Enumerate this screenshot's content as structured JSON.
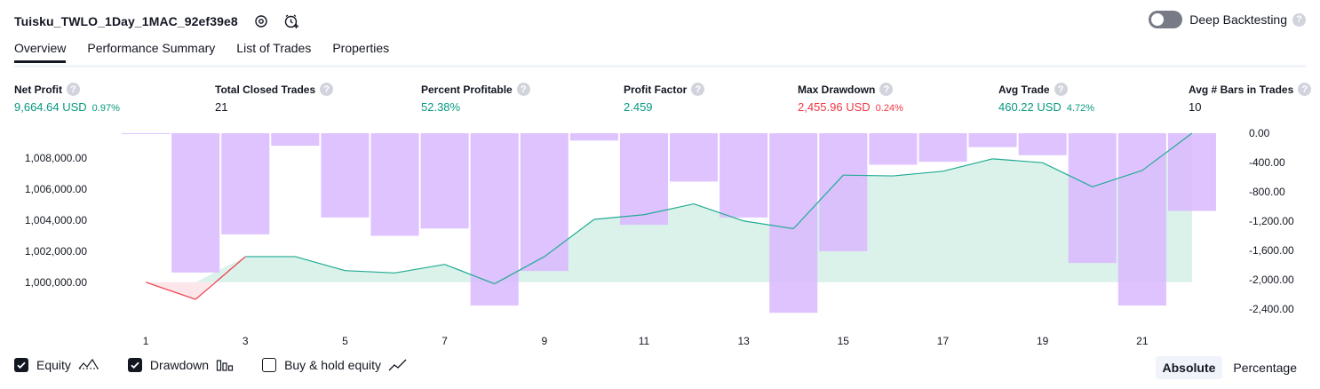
{
  "header": {
    "strategy_title": "Tuisku_TWLO_1Day_1MAC_92ef39e8",
    "deep_backtesting_label": "Deep Backtesting",
    "deep_backtesting_enabled": false
  },
  "tabs": [
    {
      "label": "Overview",
      "active": true
    },
    {
      "label": "Performance Summary",
      "active": false
    },
    {
      "label": "List of Trades",
      "active": false
    },
    {
      "label": "Properties",
      "active": false
    }
  ],
  "metrics": [
    {
      "label": "Net Profit",
      "value": "9,664.64 USD",
      "pct": "0.97%",
      "tone": "pos"
    },
    {
      "label": "Total Closed Trades",
      "value": "21",
      "pct": "",
      "tone": "neutral"
    },
    {
      "label": "Percent Profitable",
      "value": "52.38%",
      "pct": "",
      "tone": "pos"
    },
    {
      "label": "Profit Factor",
      "value": "2.459",
      "pct": "",
      "tone": "pos"
    },
    {
      "label": "Max Drawdown",
      "value": "2,455.96 USD",
      "pct": "0.24%",
      "tone": "neg"
    },
    {
      "label": "Avg Trade",
      "value": "460.22 USD",
      "pct": "4.72%",
      "tone": "pos"
    },
    {
      "label": "Avg # Bars in Trades",
      "value": "10",
      "pct": "",
      "tone": "neutral"
    }
  ],
  "colors": {
    "positive": "#089981",
    "negative": "#f23645",
    "drawdown_bar": "#d9b8ff",
    "equity_line": "#22ab94",
    "equity_fill": "#d5f0e8",
    "equity_loss_line": "#f23645"
  },
  "chart_data": {
    "type": "bar",
    "x_ticks": [
      "1",
      "3",
      "5",
      "7",
      "9",
      "11",
      "13",
      "15",
      "17",
      "19",
      "21"
    ],
    "x": [
      1,
      2,
      3,
      4,
      5,
      6,
      7,
      8,
      9,
      10,
      11,
      12,
      13,
      14,
      15,
      16,
      17,
      18,
      19,
      20,
      21,
      22
    ],
    "xlim": [
      0,
      23
    ],
    "left_axis": {
      "ticks": [
        "1,000,000.00",
        "1,002,000.00",
        "1,004,000.00",
        "1,006,000.00",
        "1,008,000.00"
      ],
      "tick_values": [
        1000000,
        1002000,
        1004000,
        1006000,
        1008000
      ],
      "ylim": [
        997700,
        1009600
      ]
    },
    "right_axis": {
      "ticks": [
        "0.00",
        "-400.00",
        "-800.00",
        "-1,200.00",
        "-1,600.00",
        "-2,000.00",
        "-2,400.00"
      ],
      "tick_values": [
        0,
        -400,
        -800,
        -1200,
        -1600,
        -2000,
        -2400
      ],
      "ylim": [
        -2520,
        0
      ]
    },
    "series": [
      {
        "name": "Equity",
        "kind": "area",
        "baseline": 1000000,
        "values": [
          1000000,
          998900,
          1001650,
          1001650,
          1000750,
          1000600,
          1001150,
          999900,
          1001650,
          1004050,
          1004350,
          1005050,
          1003950,
          1003450,
          1006900,
          1006850,
          1007150,
          1007950,
          1007700,
          1006150,
          1007200,
          1009600
        ]
      },
      {
        "name": "Drawdown",
        "kind": "bar",
        "values": [
          0,
          -1900,
          -1380,
          -170,
          -1150,
          -1400,
          -1300,
          -2350,
          -1880,
          -100,
          -1250,
          -660,
          -1150,
          -2450,
          -1610,
          -430,
          -390,
          -190,
          -300,
          -1770,
          -2350,
          -1060
        ]
      }
    ],
    "legend": [
      {
        "name": "Equity",
        "checked": true
      },
      {
        "name": "Drawdown",
        "checked": true
      },
      {
        "name": "Buy & hold equity",
        "checked": false
      }
    ],
    "grid": false
  },
  "mode_toggle": {
    "options": [
      "Absolute",
      "Percentage"
    ],
    "selected": "Absolute"
  }
}
